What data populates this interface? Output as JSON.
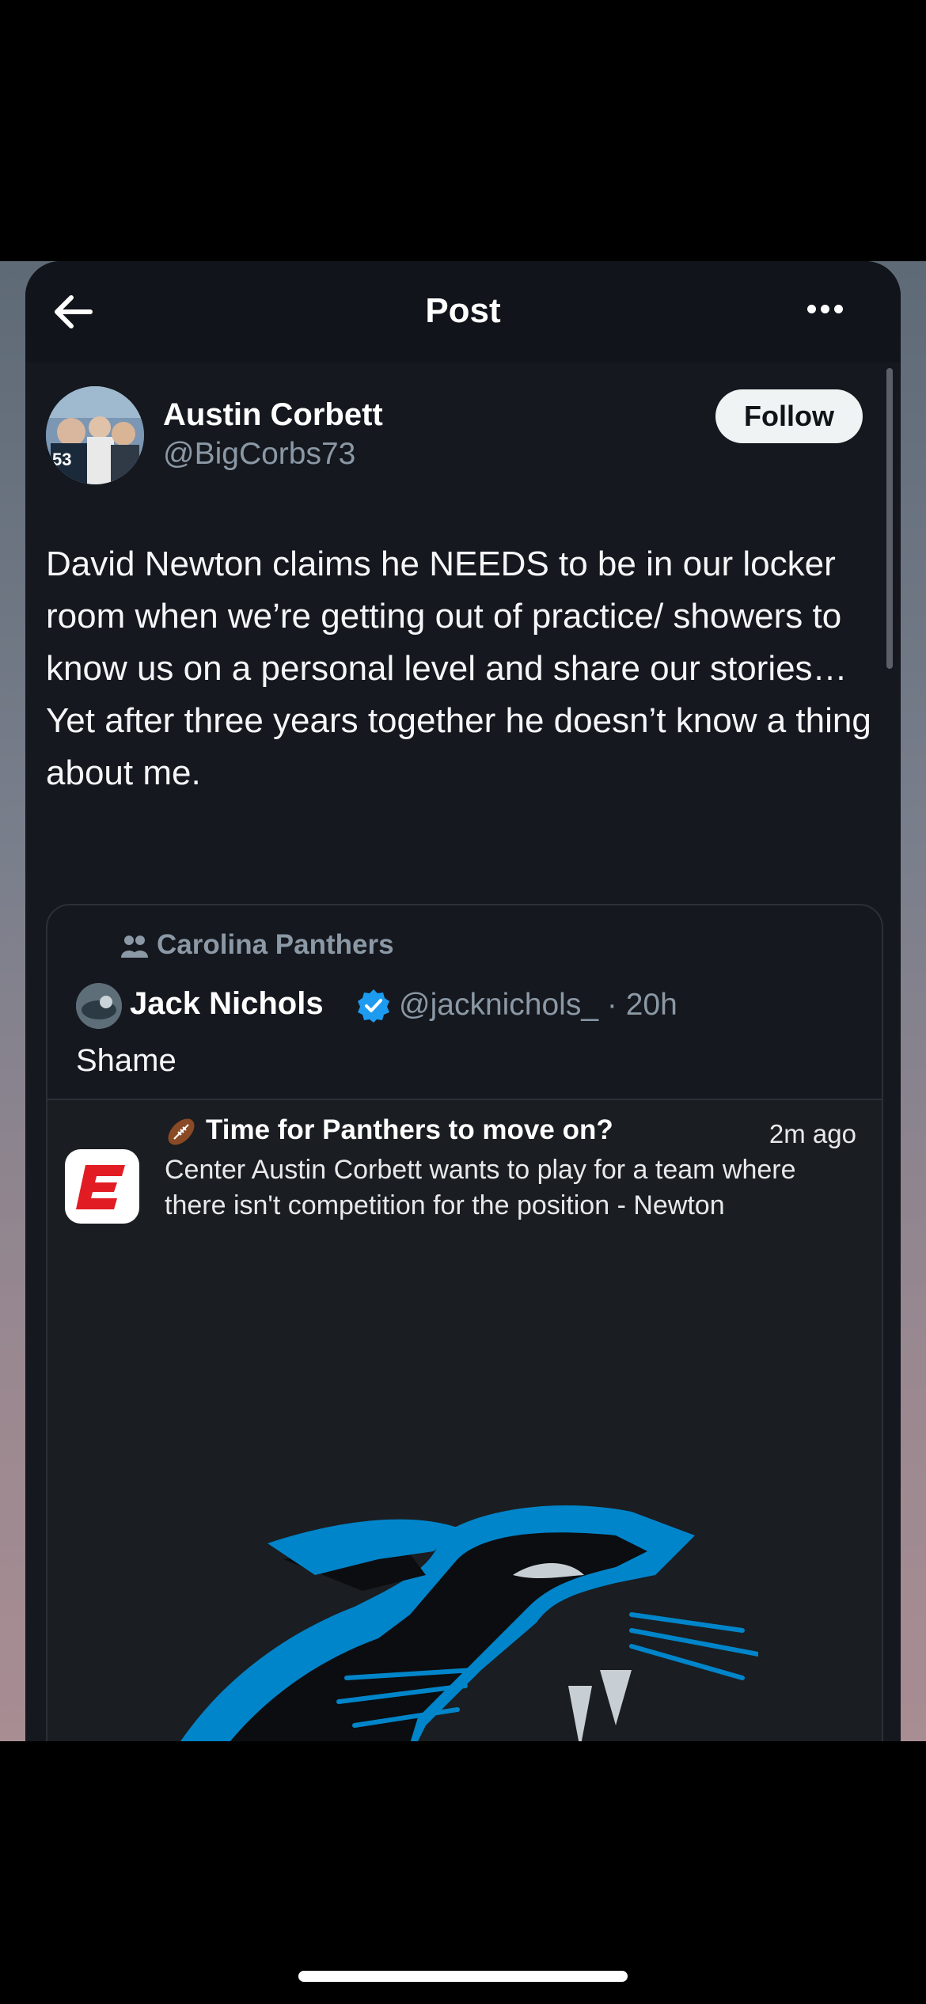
{
  "header": {
    "title": "Post",
    "back_icon": "back-arrow-icon",
    "more_icon": "more-horizontal-icon"
  },
  "post": {
    "author_name": "Austin Corbett",
    "author_handle": "@BigCorbs73",
    "follow_label": "Follow",
    "text_lines": [
      "David Newton claims he NEEDS to be in our locker room when we’re getting out of practice/ showers to know us on a personal level and share our stories…",
      "Yet after three years together he doesn’t know a thing about me."
    ]
  },
  "quoted_post": {
    "community": "Carolina Panthers",
    "author_name": "Jack Nichols",
    "handle_time": "@jacknichols_ · 20h",
    "text": "Shame",
    "media": {
      "notification_title": "Time for Panthers to move on?",
      "notification_time": "2m ago",
      "notification_body": "Center Austin Corbett wants to play for a team where there isn't competition for the position - Newton",
      "app_icon": "espn-icon"
    }
  },
  "colors": {
    "background": "#15181e",
    "accent_blue": "#1d9bf0",
    "panther_blue": "#0085ca",
    "muted_text": "#8b98a5"
  }
}
